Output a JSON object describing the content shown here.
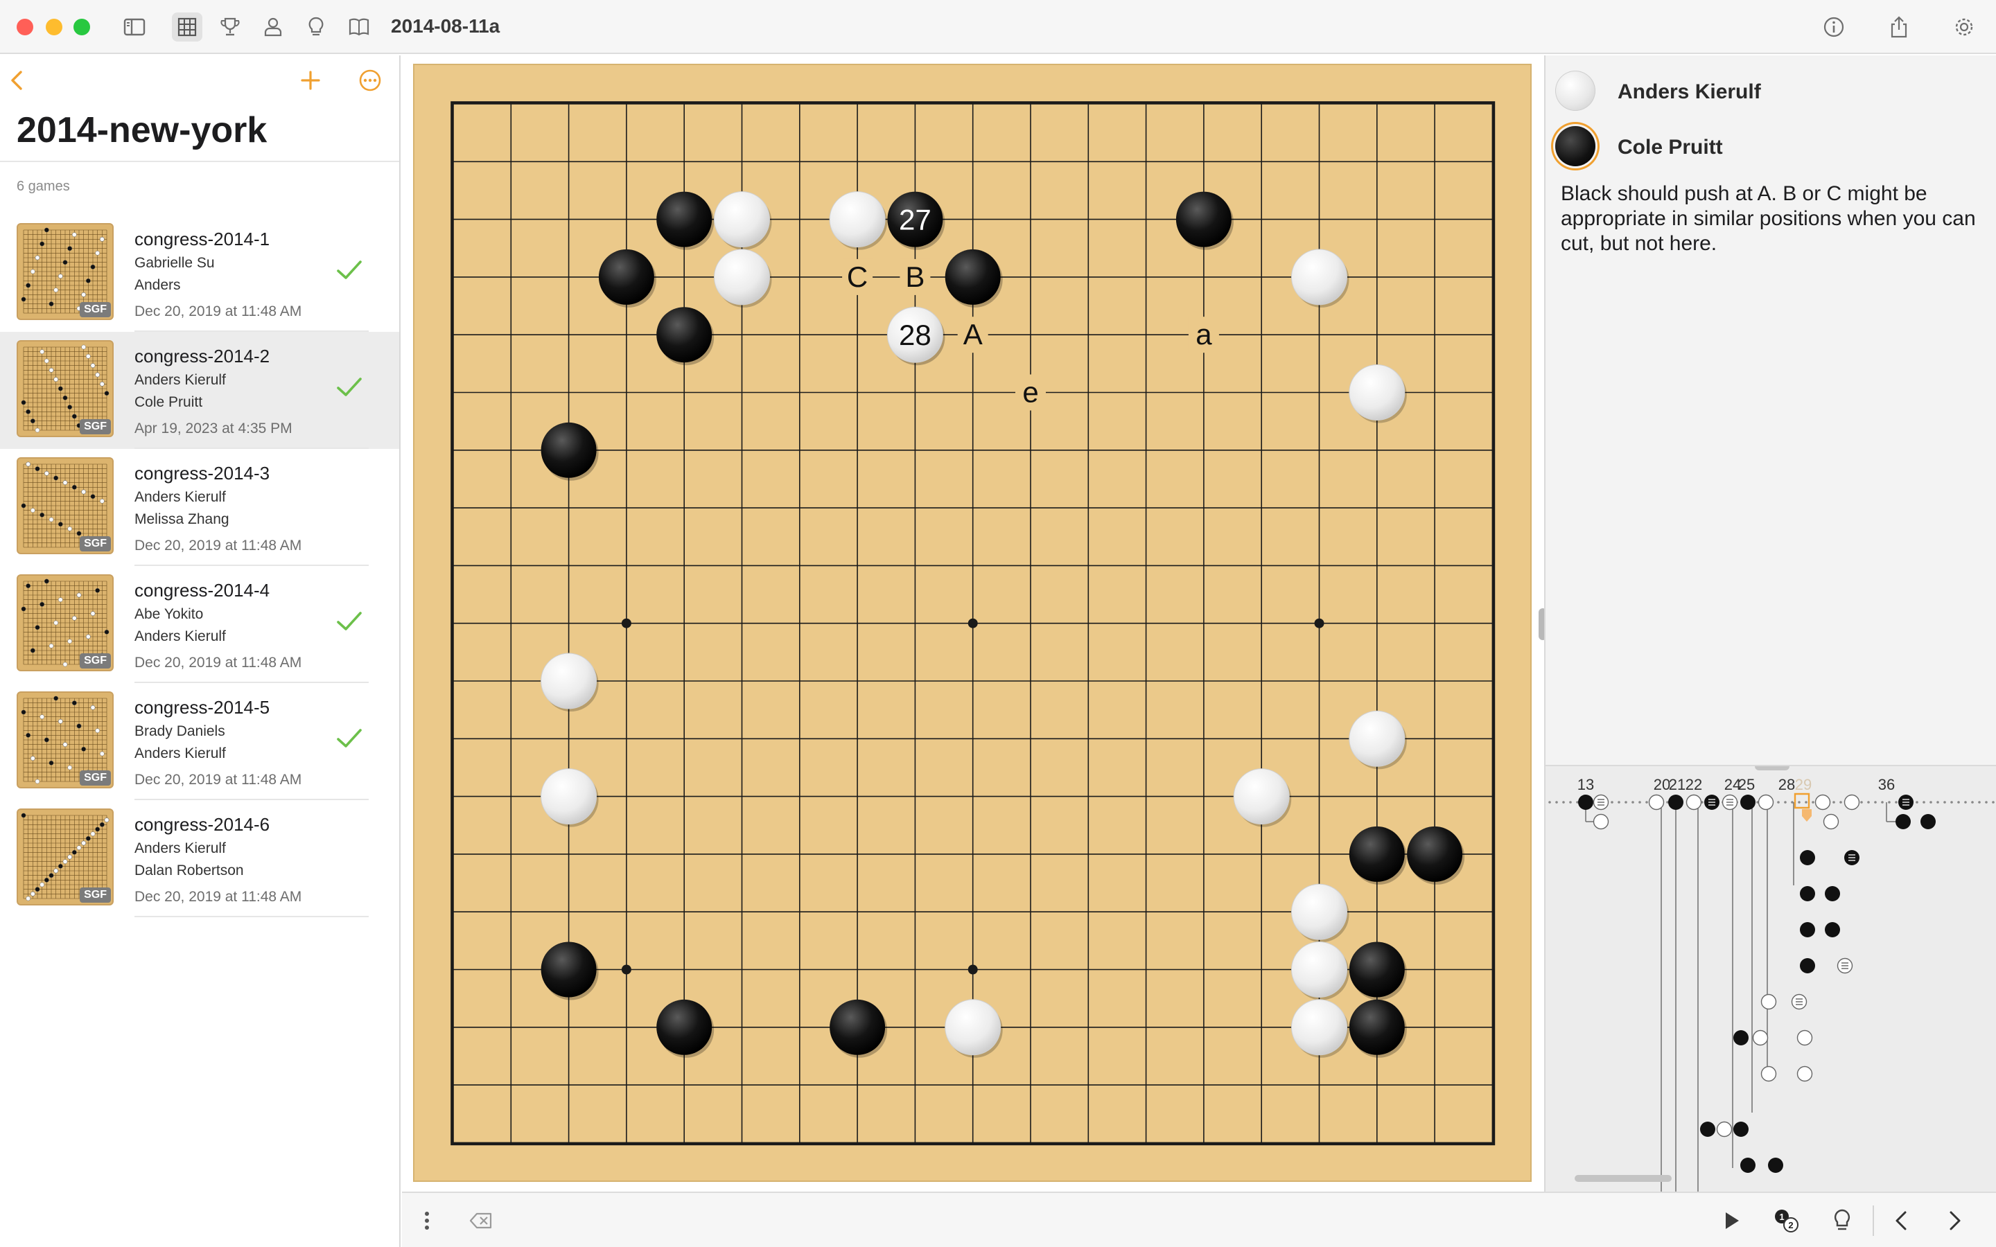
{
  "window": {
    "title": "2014-08-11a",
    "traffic_lights": {
      "close": "#ff5f57",
      "minimize": "#febc2e",
      "zoom": "#28c840"
    },
    "toolbar_icons": [
      "sidebar-toggle-icon",
      "grid-view-icon",
      "trophy-icon",
      "person-icon",
      "lightbulb-icon",
      "book-icon"
    ],
    "right_icons": [
      "info-icon",
      "share-icon",
      "gear-icon"
    ]
  },
  "sidebar": {
    "collection_title": "2014-new-york",
    "count_label": "6 games",
    "accent": "#f0a030",
    "games": [
      {
        "name": "congress-2014-1",
        "player1": "Gabrielle Su",
        "player2": "Anders",
        "date": "Dec 20, 2019 at 11:48 AM",
        "checked": true,
        "badge": "SGF"
      },
      {
        "name": "congress-2014-2",
        "player1": "Anders Kierulf",
        "player2": "Cole Pruitt",
        "date": "Apr 19, 2023 at 4:35 PM",
        "checked": true,
        "badge": "SGF",
        "selected": true
      },
      {
        "name": "congress-2014-3",
        "player1": "Anders Kierulf",
        "player2": "Melissa Zhang",
        "date": "Dec 20, 2019 at 11:48 AM",
        "checked": false,
        "badge": "SGF"
      },
      {
        "name": "congress-2014-4",
        "player1": "Abe Yokito",
        "player2": "Anders Kierulf",
        "date": "Dec 20, 2019 at 11:48 AM",
        "checked": true,
        "badge": "SGF"
      },
      {
        "name": "congress-2014-5",
        "player1": "Brady Daniels",
        "player2": "Anders Kierulf",
        "date": "Dec 20, 2019 at 11:48 AM",
        "checked": true,
        "badge": "SGF"
      },
      {
        "name": "congress-2014-6",
        "player1": "Anders Kierulf",
        "player2": "Dalan Robertson",
        "date": "Dec 20, 2019 at 11:48 AM",
        "checked": false,
        "badge": "SGF"
      }
    ]
  },
  "board": {
    "size": 19,
    "wood_color": "#ebc98a",
    "black_stones": [
      [
        4,
        2
      ],
      [
        3,
        3
      ],
      [
        4,
        4
      ],
      [
        8,
        2
      ],
      [
        9,
        3
      ],
      [
        13,
        2
      ],
      [
        2,
        6
      ],
      [
        2,
        15
      ],
      [
        4,
        16
      ],
      [
        7,
        16
      ],
      [
        16,
        13
      ],
      [
        17,
        13
      ],
      [
        16,
        15
      ],
      [
        16,
        16
      ]
    ],
    "white_stones": [
      [
        5,
        2
      ],
      [
        5,
        3
      ],
      [
        7,
        2
      ],
      [
        8,
        4
      ],
      [
        15,
        3
      ],
      [
        16,
        5
      ],
      [
        2,
        10
      ],
      [
        16,
        11
      ],
      [
        2,
        12
      ],
      [
        14,
        12
      ],
      [
        15,
        14
      ],
      [
        15,
        15
      ],
      [
        15,
        16
      ],
      [
        9,
        16
      ]
    ],
    "numbered": [
      {
        "x": 8,
        "y": 2,
        "n": "27",
        "color": "black"
      },
      {
        "x": 8,
        "y": 4,
        "n": "28",
        "color": "white"
      }
    ],
    "letters": [
      {
        "x": 7,
        "y": 3,
        "t": "C"
      },
      {
        "x": 8,
        "y": 3,
        "t": "B"
      },
      {
        "x": 9,
        "y": 4,
        "t": "A"
      },
      {
        "x": 13,
        "y": 4,
        "t": "a"
      },
      {
        "x": 10,
        "y": 5,
        "t": "e"
      }
    ]
  },
  "players": {
    "white": "Anders Kierulf",
    "black": "Cole Pruitt",
    "to_move_ring": "#f0a030"
  },
  "comment": "Black should push at A. B or C might be appropriate in similar positions when you can cut, but not here.",
  "tree": {
    "labels": [
      {
        "t": "13"
      },
      {
        "t": "20"
      },
      {
        "t": "21"
      },
      {
        "t": "22"
      },
      {
        "t": "24"
      },
      {
        "t": "25"
      },
      {
        "t": "28"
      },
      {
        "t": "29"
      },
      {
        "t": "36"
      }
    ]
  },
  "bottom_icons": [
    "more-vertical-icon",
    "delete-icon",
    "play-icon",
    "move-numbers-icon",
    "hint-lightbulb-icon",
    "previous-icon",
    "next-icon"
  ]
}
